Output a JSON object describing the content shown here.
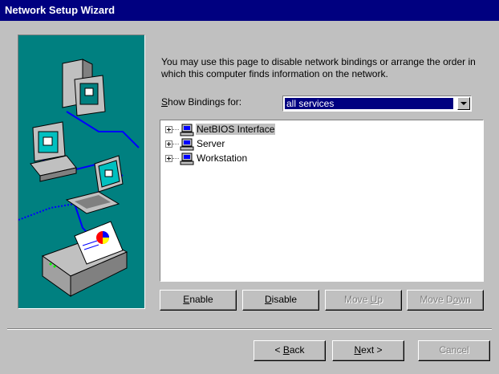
{
  "window": {
    "title": "Network Setup Wizard"
  },
  "description": "You may use this page to disable network bindings or arrange the order in which this computer finds information on the network.",
  "show_bindings": {
    "label_prefix": "",
    "label_accel": "S",
    "label_rest": "how Bindings for:",
    "selected": "all services"
  },
  "tree": {
    "items": [
      {
        "label": "NetBIOS Interface",
        "icon": "network-computer-icon",
        "selected": true
      },
      {
        "label": "Server",
        "icon": "network-computer-icon",
        "selected": false
      },
      {
        "label": "Workstation",
        "icon": "network-computer-icon",
        "selected": false
      }
    ]
  },
  "buttons": {
    "enable": {
      "accel": "E",
      "rest": "nable"
    },
    "disable": {
      "accel": "D",
      "rest": "isable"
    },
    "move_up": {
      "pre": "Move ",
      "accel": "U",
      "rest": "p"
    },
    "move_down": {
      "pre": "Move D",
      "accel": "o",
      "rest": "wn"
    },
    "back": {
      "pre": "< ",
      "accel": "B",
      "rest": "ack"
    },
    "next": {
      "accel": "N",
      "rest": "ext >"
    },
    "cancel": "Cancel"
  },
  "colors": {
    "title_bar": "#000080",
    "face": "#c0c0c0",
    "illustration_bg": "#008080",
    "selection": "#000080"
  }
}
